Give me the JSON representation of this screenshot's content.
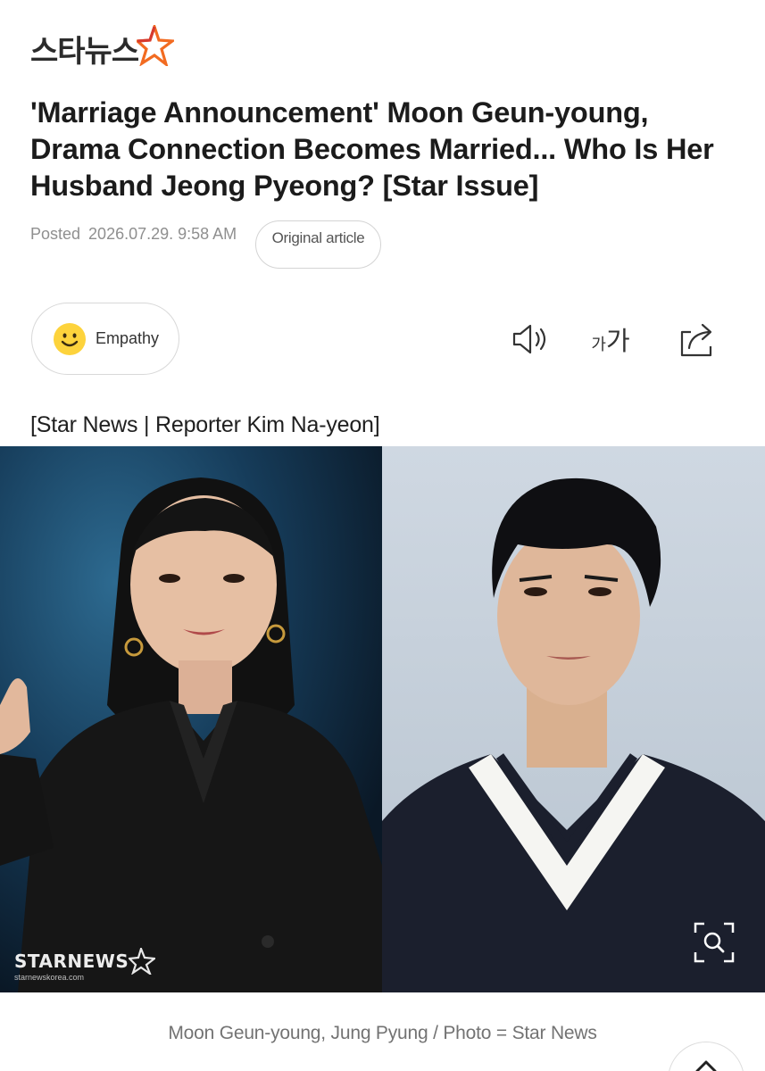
{
  "header": {
    "logo_text": "스타뉴스",
    "logo_star_icon": "star-icon",
    "brand_colors": {
      "star_orange": "#f26b21",
      "star_red": "#d63a2f",
      "logo_dark": "#2b2b2b"
    }
  },
  "article": {
    "title": "'Marriage Announcement' Moon Geun-young, Drama Connection Becomes Married... Who Is Her Husband Jeong Pyeong? [Star Issue]",
    "posted_label": "Posted",
    "posted_datetime": "2026.07.29. 9:58 AM",
    "original_article_label": "Original article",
    "byline": "[Star News | Reporter Kim Na-yeon]"
  },
  "toolbar": {
    "empathy_label": "Empathy",
    "empathy_icon": "smiley-icon",
    "speaker_icon": "speaker-icon",
    "font_size_small": "가",
    "font_size_big": "가",
    "share_icon": "share-icon"
  },
  "photo": {
    "watermark": "STARNEWS",
    "watermark_url": "starnewskorea.com",
    "zoom_icon": "zoom-icon",
    "caption": "Moon Geun-young, Jung Pyung / Photo = Star News"
  },
  "floating": {
    "scroll_top_icon": "arrow-up-icon"
  }
}
